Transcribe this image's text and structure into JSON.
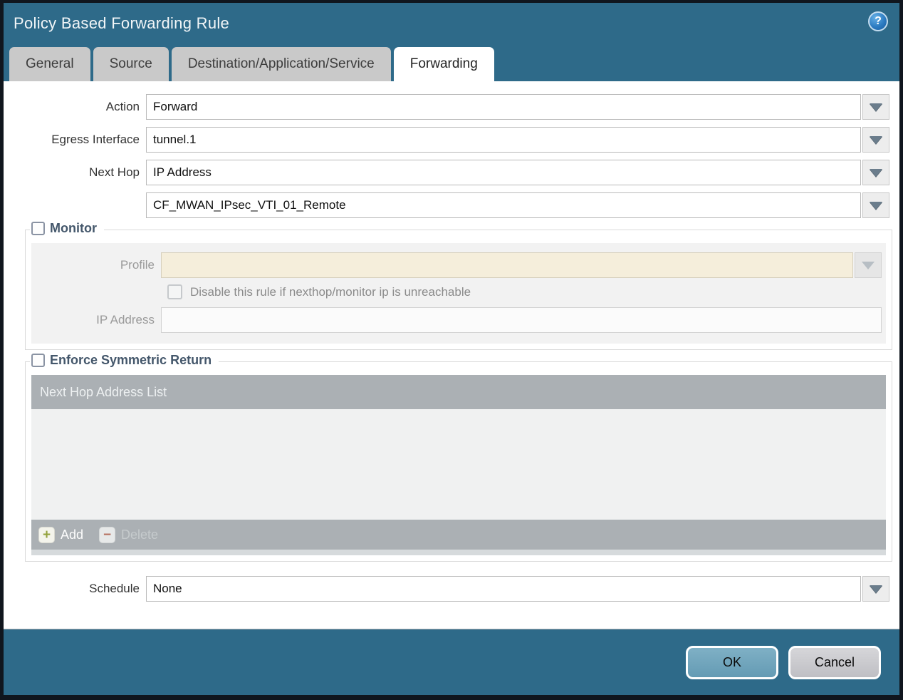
{
  "colors": {
    "teal": "#2E6A89",
    "window_border": "#10161e",
    "tab_inactive_bg": "#c9c9c9",
    "tab_text": "#3c3c3c",
    "legend_text": "#44576b",
    "table_gray": "#abb0b4",
    "profile_bg": "#f5eedb",
    "add_green": "#93a23c",
    "delete_red": "#b5705f",
    "ok_bg": "#70a5bc",
    "cancel_bg": "#c9c9cd"
  },
  "window": {
    "title": "Policy Based Forwarding Rule",
    "help_icon": "question-mark-icon",
    "help_glyph": "?"
  },
  "tabs": [
    {
      "label": "General",
      "active": false
    },
    {
      "label": "Source",
      "active": false
    },
    {
      "label": "Destination/Application/Service",
      "active": false
    },
    {
      "label": "Forwarding",
      "active": true
    }
  ],
  "form": {
    "action": {
      "label": "Action",
      "value": "Forward"
    },
    "egress_interface": {
      "label": "Egress Interface",
      "value": "tunnel.1"
    },
    "next_hop": {
      "label": "Next Hop",
      "value": "IP Address"
    },
    "next_hop_address": {
      "value": "CF_MWAN_IPsec_VTI_01_Remote"
    },
    "schedule": {
      "label": "Schedule",
      "value": "None"
    }
  },
  "monitor": {
    "legend": "Monitor",
    "checked": false,
    "profile": {
      "label": "Profile",
      "value": ""
    },
    "disable_rule": {
      "label": "Disable this rule if nexthop/monitor ip is unreachable",
      "checked": false
    },
    "ip_address": {
      "label": "IP Address",
      "value": ""
    }
  },
  "symmetric_return": {
    "legend": "Enforce Symmetric Return",
    "checked": false,
    "table_header": "Next Hop Address List",
    "rows": [],
    "add_label": "Add",
    "delete_label": "Delete",
    "add_icon_glyph": "+",
    "delete_icon_glyph": "−"
  },
  "footer": {
    "ok_label": "OK",
    "cancel_label": "Cancel"
  }
}
